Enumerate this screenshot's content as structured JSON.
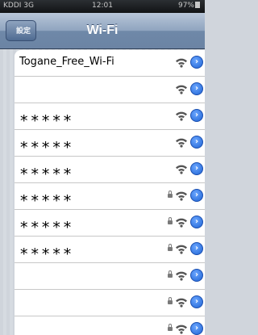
{
  "status_bar": {
    "carrier": "KDDI 3G",
    "time": "12:01",
    "battery": "97%"
  },
  "nav": {
    "back_label": "設定",
    "title": "Wi-Fi"
  },
  "networks": [
    {
      "ssid": "Togane_Free_Wi-Fi",
      "locked": false,
      "masked": false
    },
    {
      "ssid": "",
      "locked": false,
      "masked": false
    },
    {
      "ssid": "*****",
      "locked": false,
      "masked": true
    },
    {
      "ssid": "*****",
      "locked": false,
      "masked": true
    },
    {
      "ssid": "*****",
      "locked": false,
      "masked": true
    },
    {
      "ssid": "*****",
      "locked": true,
      "masked": true
    },
    {
      "ssid": "*****",
      "locked": true,
      "masked": true
    },
    {
      "ssid": "*****",
      "locked": true,
      "masked": true
    },
    {
      "ssid": "",
      "locked": true,
      "masked": false
    },
    {
      "ssid": "",
      "locked": true,
      "masked": false
    },
    {
      "ssid": "",
      "locked": true,
      "masked": false
    }
  ],
  "icons": {
    "lock": "lock-icon",
    "wifi": "wifi-signal-icon",
    "info": "detail-disclosure-icon"
  },
  "colors": {
    "nav_bar": "#6f88a8",
    "info_button": "#1f63d3"
  }
}
